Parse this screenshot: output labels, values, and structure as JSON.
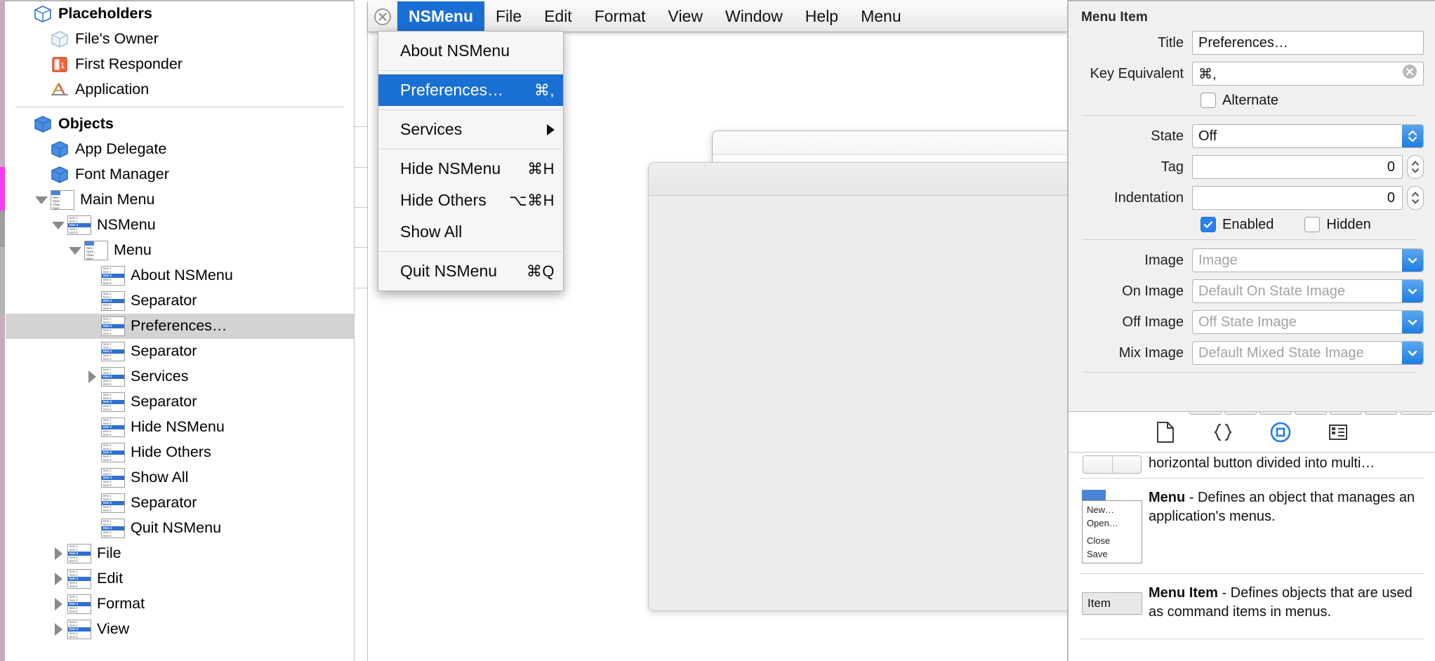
{
  "outline": {
    "sections": [
      {
        "header": {
          "label": "Placeholders",
          "icon": "cube-outline-icon"
        },
        "items": [
          {
            "label": "File's Owner",
            "icon": "cube-ghost-icon",
            "indent": 1,
            "twisty": "none"
          },
          {
            "label": "First Responder",
            "icon": "first-responder-icon",
            "indent": 1,
            "twisty": "none"
          },
          {
            "label": "Application",
            "icon": "application-icon",
            "indent": 1,
            "twisty": "none"
          }
        ]
      },
      {
        "header": {
          "label": "Objects",
          "icon": "cube-icon"
        },
        "items": [
          {
            "label": "App Delegate",
            "icon": "cube-icon",
            "indent": 1,
            "twisty": "none"
          },
          {
            "label": "Font Manager",
            "icon": "cube-icon",
            "indent": 1,
            "twisty": "none"
          },
          {
            "label": "Main Menu",
            "icon": "menu-icon",
            "indent": 1,
            "twisty": "down"
          },
          {
            "label": "NSMenu",
            "icon": "menu-item-icon",
            "indent": 2,
            "twisty": "down"
          },
          {
            "label": "Menu",
            "icon": "menu-icon",
            "indent": 3,
            "twisty": "down"
          },
          {
            "label": "About NSMenu",
            "icon": "menu-item-icon",
            "indent": 4,
            "twisty": "none"
          },
          {
            "label": "Separator",
            "icon": "menu-item-icon",
            "indent": 4,
            "twisty": "none"
          },
          {
            "label": "Preferences…",
            "icon": "menu-item-icon",
            "indent": 4,
            "twisty": "none",
            "selected": true
          },
          {
            "label": "Separator",
            "icon": "menu-item-icon",
            "indent": 4,
            "twisty": "none"
          },
          {
            "label": "Services",
            "icon": "menu-item-icon",
            "indent": 4,
            "twisty": "right"
          },
          {
            "label": "Separator",
            "icon": "menu-item-icon",
            "indent": 4,
            "twisty": "none"
          },
          {
            "label": "Hide NSMenu",
            "icon": "menu-item-icon",
            "indent": 4,
            "twisty": "none"
          },
          {
            "label": "Hide Others",
            "icon": "menu-item-icon",
            "indent": 4,
            "twisty": "none"
          },
          {
            "label": "Show All",
            "icon": "menu-item-icon",
            "indent": 4,
            "twisty": "none"
          },
          {
            "label": "Separator",
            "icon": "menu-item-icon",
            "indent": 4,
            "twisty": "none"
          },
          {
            "label": "Quit NSMenu",
            "icon": "menu-item-icon",
            "indent": 4,
            "twisty": "none"
          },
          {
            "label": "File",
            "icon": "menu-item-icon",
            "indent": 2,
            "twisty": "right"
          },
          {
            "label": "Edit",
            "icon": "menu-item-icon",
            "indent": 2,
            "twisty": "right"
          },
          {
            "label": "Format",
            "icon": "menu-item-icon",
            "indent": 2,
            "twisty": "right"
          },
          {
            "label": "View",
            "icon": "menu-item-icon",
            "indent": 2,
            "twisty": "right"
          }
        ]
      }
    ]
  },
  "canvas": {
    "menubar": {
      "close_icon": "close-circle-icon",
      "items": [
        {
          "label": "NSMenu",
          "active": true
        },
        {
          "label": "File",
          "active": false
        },
        {
          "label": "Edit",
          "active": false
        },
        {
          "label": "Format",
          "active": false
        },
        {
          "label": "View",
          "active": false
        },
        {
          "label": "Window",
          "active": false
        },
        {
          "label": "Help",
          "active": false
        },
        {
          "label": "Menu",
          "active": false
        }
      ]
    },
    "dropdown": {
      "groups": [
        [
          {
            "label": "About NSMenu",
            "key": "",
            "highlighted": false,
            "submenu": false
          }
        ],
        [
          {
            "label": "Preferences…",
            "key": "⌘,",
            "highlighted": true,
            "submenu": false
          }
        ],
        [
          {
            "label": "Services",
            "key": "",
            "highlighted": false,
            "submenu": true
          }
        ],
        [
          {
            "label": "Hide NSMenu",
            "key": "⌘H",
            "highlighted": false,
            "submenu": false
          },
          {
            "label": "Hide Others",
            "key": "⌥⌘H",
            "highlighted": false,
            "submenu": false
          },
          {
            "label": "Show All",
            "key": "",
            "highlighted": false,
            "submenu": false
          }
        ],
        [
          {
            "label": "Quit NSMenu",
            "key": "⌘Q",
            "highlighted": false,
            "submenu": false
          }
        ]
      ]
    }
  },
  "inspector": {
    "title": "Menu Item",
    "fields": {
      "title_label": "Title",
      "title_value": "Preferences…",
      "key_equivalent_label": "Key Equivalent",
      "key_equivalent_value": "⌘,",
      "key_equivalent_clear_icon": "clear-circle-icon",
      "alternate_label": "Alternate",
      "alternate_checked": false,
      "state_label": "State",
      "state_value": "Off",
      "tag_label": "Tag",
      "tag_value": "0",
      "indentation_label": "Indentation",
      "indentation_value": "0",
      "enabled_label": "Enabled",
      "enabled_checked": true,
      "hidden_label": "Hidden",
      "hidden_checked": false,
      "image_label": "Image",
      "image_placeholder": "Image",
      "on_image_label": "On Image",
      "on_image_placeholder": "Default On State Image",
      "off_image_label": "Off Image",
      "off_image_placeholder": "Off State Image",
      "mix_image_label": "Mix Image",
      "mix_image_placeholder": "Default Mixed State Image"
    }
  },
  "library": {
    "toolbar": [
      {
        "icon": "file-template-icon",
        "selected": false
      },
      {
        "icon": "code-snippet-icon",
        "selected": false
      },
      {
        "icon": "object-library-icon",
        "selected": true
      },
      {
        "icon": "media-library-icon",
        "selected": false
      }
    ],
    "items": [
      {
        "thumb": "segmented-control-thumb",
        "name": "",
        "desc_truncated": "horizontal button divided into multi…",
        "partial": true
      },
      {
        "thumb": "menu-thumb",
        "thumb_lines": [
          "New…",
          "Open…",
          "Close",
          "Save"
        ],
        "name": "Menu",
        "desc": " - Defines an object that manages an application's menus."
      },
      {
        "thumb": "menu-item-thumb",
        "thumb_label": "Item",
        "name": "Menu Item",
        "desc": " - Defines objects that are used as command items in menus."
      }
    ]
  },
  "colors": {
    "accent_blue": "#1a6fd4",
    "selection_grey": "#d3d3d3",
    "inspector_bg": "#f0f0f0"
  }
}
